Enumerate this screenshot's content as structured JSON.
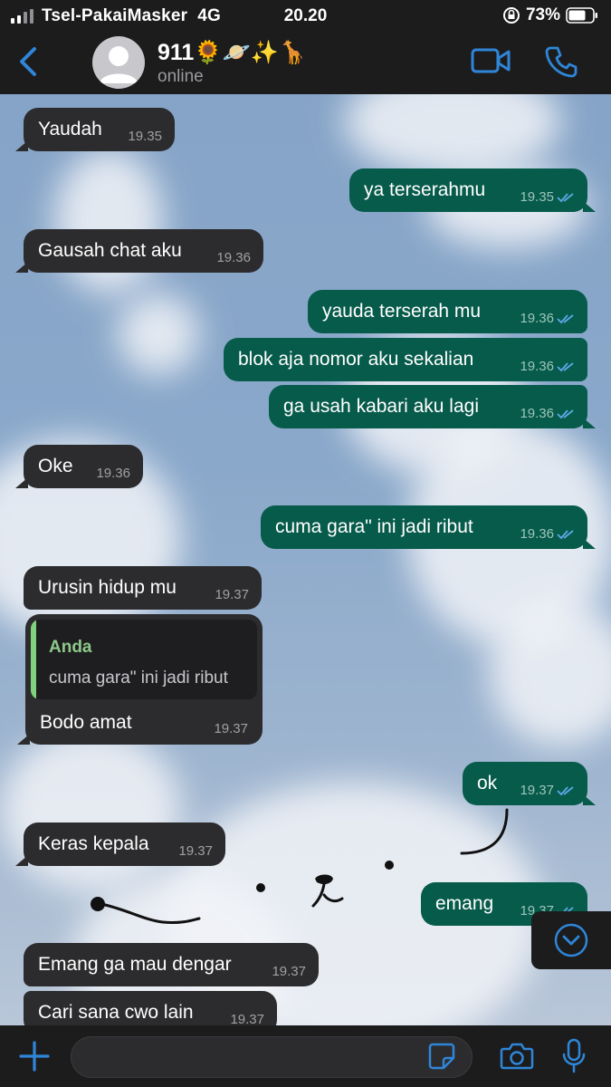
{
  "status": {
    "carrier": "Tsel-PakaiMasker",
    "network": "4G",
    "time": "20.20",
    "battery": "73%"
  },
  "header": {
    "name": "911🌻🪐✨🦒",
    "subtitle": "online"
  },
  "messages": [
    {
      "text": "Yaudah",
      "time": "19.35",
      "dir": "in"
    },
    {
      "text": "ya terserahmu",
      "time": "19.35",
      "dir": "out"
    },
    {
      "text": "Gausah chat aku",
      "time": "19.36",
      "dir": "in"
    },
    {
      "text": "yauda terserah mu",
      "time": "19.36",
      "dir": "out"
    },
    {
      "text": "blok aja nomor aku sekalian",
      "time": "19.36",
      "dir": "out"
    },
    {
      "text": "ga usah kabari aku lagi",
      "time": "19.36",
      "dir": "out"
    },
    {
      "text": "Oke",
      "time": "19.36",
      "dir": "in"
    },
    {
      "text": "cuma gara\" ini jadi ribut",
      "time": "19.36",
      "dir": "out"
    },
    {
      "text": "Urusin hidup mu",
      "time": "19.37",
      "dir": "in"
    },
    {
      "text": "ok",
      "time": "19.37",
      "dir": "out"
    },
    {
      "text": "Keras kepala",
      "time": "19.37",
      "dir": "in"
    },
    {
      "text": "emang",
      "time": "19.37",
      "dir": "out"
    },
    {
      "text": "Emang ga mau dengar",
      "time": "19.37",
      "dir": "in"
    },
    {
      "text": "Cari sana cwo lain",
      "time": "19.37",
      "dir": "in"
    }
  ],
  "reply": {
    "quote_name": "Anda",
    "quote_text": "cuma gara\" ini jadi ribut",
    "text": "Bodo amat",
    "time": "19.37"
  },
  "colors": {
    "accent": "#2f86d8",
    "incoming": "#2c2c2e",
    "outgoing": "#075b4b",
    "ticks": "#5aa9e6"
  }
}
